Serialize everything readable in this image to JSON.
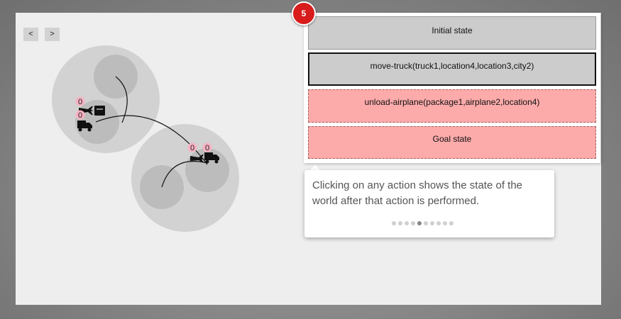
{
  "navigation": {
    "prev_label": "<",
    "next_label": ">"
  },
  "world": {
    "counters": {
      "plane_city1": "0",
      "truck_city1": "0",
      "plane_city2": "0",
      "truck_city2": "0"
    }
  },
  "step_badge": "5",
  "actions": {
    "initial": "Initial state",
    "move": "move-truck(truck1,location4,location3,city2)",
    "unload": "unload-airplane(package1,airplane2,location4)",
    "goal": "Goal state"
  },
  "tooltip": {
    "text": "Clicking on any action shows the state of the world after that action is performed.",
    "total_pages": 10,
    "active_page": 5
  }
}
